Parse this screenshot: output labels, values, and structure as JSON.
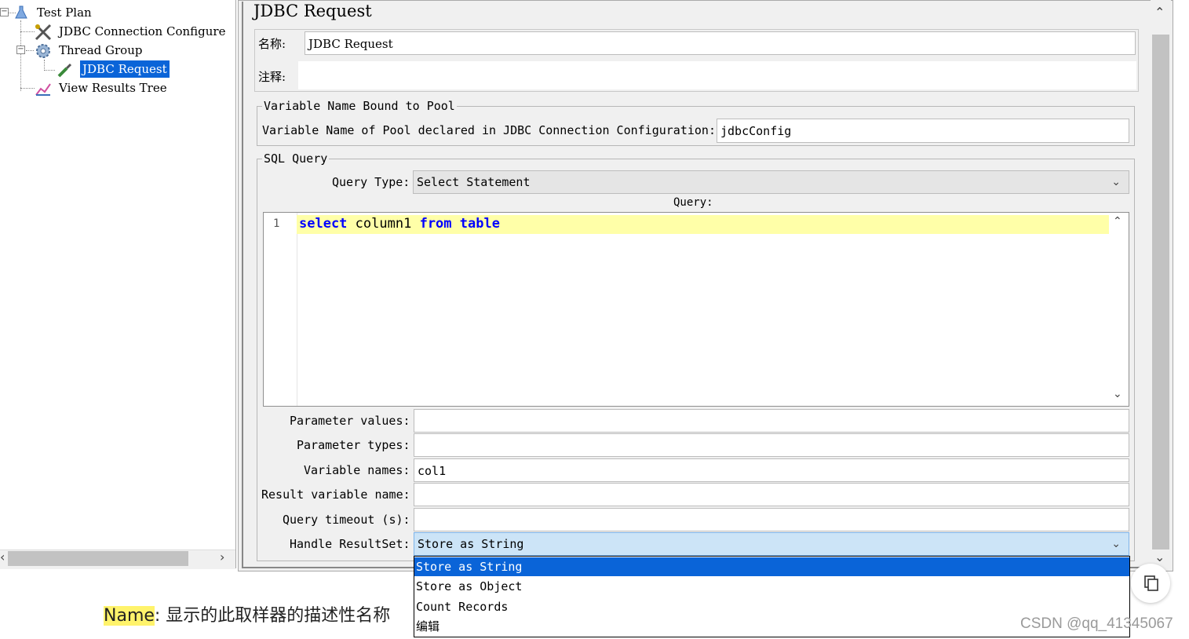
{
  "tree": {
    "items": [
      {
        "label": "Test Plan",
        "icon": "flask-icon"
      },
      {
        "label": "JDBC Connection Configure",
        "icon": "tools-icon"
      },
      {
        "label": "Thread Group",
        "icon": "gear-icon"
      },
      {
        "label": "JDBC Request",
        "icon": "pipette-icon",
        "selected": true
      },
      {
        "label": "View Results Tree",
        "icon": "chart-icon"
      }
    ]
  },
  "panel": {
    "title": "JDBC Request",
    "name_label": "名称:",
    "name_value": "JDBC Request",
    "comment_label": "注释:",
    "comment_value": ""
  },
  "pool": {
    "legend": "Variable Name Bound to Pool",
    "label": "Variable Name of Pool declared in JDBC Connection Configuration:",
    "value": "jdbcConfig"
  },
  "sql": {
    "legend": "SQL Query",
    "query_type_label": "Query Type:",
    "query_type_value": "Select Statement",
    "query_label": "Query:",
    "line_number": "1",
    "code_kw1": "select",
    "code_col": "column1",
    "code_kw2": "from",
    "code_kw3": "table"
  },
  "params": {
    "param_values_label": "Parameter values:",
    "param_values": "",
    "param_types_label": "Parameter types:",
    "param_types": "",
    "variable_names_label": "Variable names:",
    "variable_names": "col1",
    "result_var_label": "Result variable name:",
    "result_var": "",
    "timeout_label": "Query timeout (s):",
    "timeout": "",
    "handle_label": "Handle ResultSet:",
    "handle_value": "Store as String"
  },
  "dropdown": {
    "options": [
      "Store as String",
      "Store as Object",
      "Count Records",
      "编辑"
    ]
  },
  "caption": {
    "name": "Name",
    "rest": ": 显示的此取样器的描述性名称"
  },
  "watermark": "CSDN @qq_41345067"
}
